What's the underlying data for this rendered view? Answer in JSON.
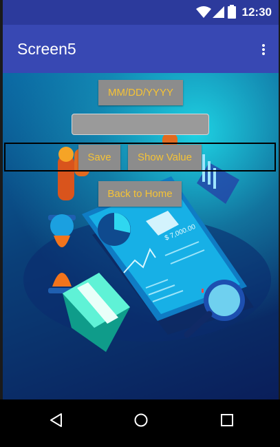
{
  "status_bar": {
    "time": "12:30",
    "icons": [
      "wifi-icon",
      "cellular-signal-icon",
      "battery-icon"
    ]
  },
  "app_bar": {
    "title": "Screen5",
    "overflow_icon": "more-vert-icon"
  },
  "form": {
    "date_button_label": "MM/DD/YYYY",
    "text_input_value": "",
    "save_label": "Save",
    "show_value_label": "Show Value",
    "back_label": "Back to Home"
  },
  "illustration": {
    "amount_text": "$ 7,000.00"
  },
  "nav_bar": {
    "icons": [
      "back-icon",
      "home-icon",
      "recents-icon"
    ]
  },
  "colors": {
    "status_bar": "#2c3a9c",
    "app_bar": "#3848b3",
    "button_bg": "#8c8c8c",
    "button_text": "#f6c335"
  }
}
